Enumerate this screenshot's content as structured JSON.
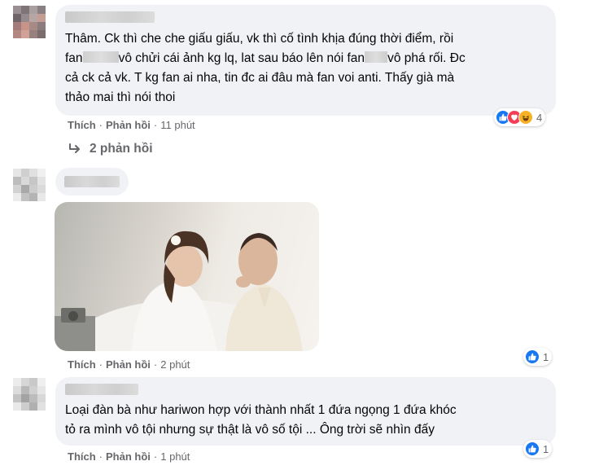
{
  "comments": [
    {
      "text_parts": [
        "Thâm. Ck thì che che giấu giấu, vk thì cố tình khịa đúng thời điểm, rồi\nfan",
        "vô chửi cái ảnh kg lq, lat sau báo lên nói fan",
        "vô phá rối. Đc\ncả ck cả vk. T kg fan ai nha, tin đc ai đâu mà fan voi anti. Thấy già mà\nthảo mai thì nói thoi"
      ],
      "like_label": "Thích",
      "reply_label": "Phản hồi",
      "time": "11 phút",
      "reaction_count": "4",
      "reaction_icons": [
        "like-icon",
        "love-icon",
        "haha-icon"
      ],
      "replies_label": "2 phản hồi"
    },
    {
      "like_label": "Thích",
      "reply_label": "Phản hồi",
      "time": "2 phút",
      "reaction_count": "1",
      "reaction_icons": [
        "like-icon"
      ]
    },
    {
      "text": "Loại đàn bà như hariwon hợp với thành nhất 1 đứa ngọng 1 đứa khóc\ntỏ ra mình vô tội nhưng sự thật là vô số tội ... Ông trời sẽ nhìn đấy",
      "like_label": "Thích",
      "reply_label": "Phản hồi",
      "time": "1 phút",
      "reaction_count": "1",
      "reaction_icons": [
        "like-icon"
      ]
    }
  ],
  "colors": {
    "bubble": "#f0f2f5",
    "secondary_text": "#65676b",
    "like_blue": "#1877f2",
    "love_red": "#f33e58",
    "haha_yellow": "#f7b125"
  }
}
